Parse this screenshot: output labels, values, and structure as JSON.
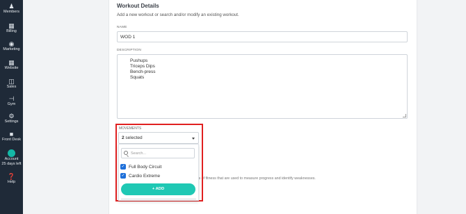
{
  "sidebar": {
    "items": [
      {
        "label": "Members",
        "icon": "members-icon"
      },
      {
        "label": "Billing",
        "icon": "billing-icon"
      },
      {
        "label": "Marketing",
        "icon": "marketing-icon"
      },
      {
        "label": "Website",
        "icon": "website-icon"
      },
      {
        "label": "Sales",
        "icon": "sales-icon"
      },
      {
        "label": "Gym",
        "icon": "dumbbell-icon"
      },
      {
        "label": "Settings",
        "icon": "gear-icon"
      },
      {
        "label": "Front Desk",
        "icon": "front-desk-icon"
      },
      {
        "label": "Account",
        "sub": "25 days left",
        "icon": "account-icon"
      },
      {
        "label": "Help",
        "icon": "help-icon"
      }
    ]
  },
  "header": {
    "title": "Workout Details",
    "subtitle": "Add a new workout or search and/or modify an existing workout."
  },
  "form": {
    "name_label": "NAME",
    "name_value": "WOD 1",
    "description_label": "DESCRIPTION",
    "description_lines": [
      "Pushups",
      "Triceps Dips",
      "Bench-press",
      "Squats"
    ]
  },
  "movements": {
    "label": "MOVEMENTS",
    "selected_count": "2",
    "selected_suffix": " selected",
    "search_placeholder": "Search...",
    "options": [
      {
        "label": "Full Body Circuit",
        "checked": true
      },
      {
        "label": "Cardio Extreme",
        "checked": true
      }
    ],
    "add_button": "+ ADD"
  },
  "hint": "ts of fitness that are used to measure progress and identify weaknesses.",
  "colors": {
    "sidebar_bg": "#1f2a38",
    "accent": "#1fc8b4",
    "checkbox": "#1e6fd9",
    "highlight_border": "#e02020"
  }
}
